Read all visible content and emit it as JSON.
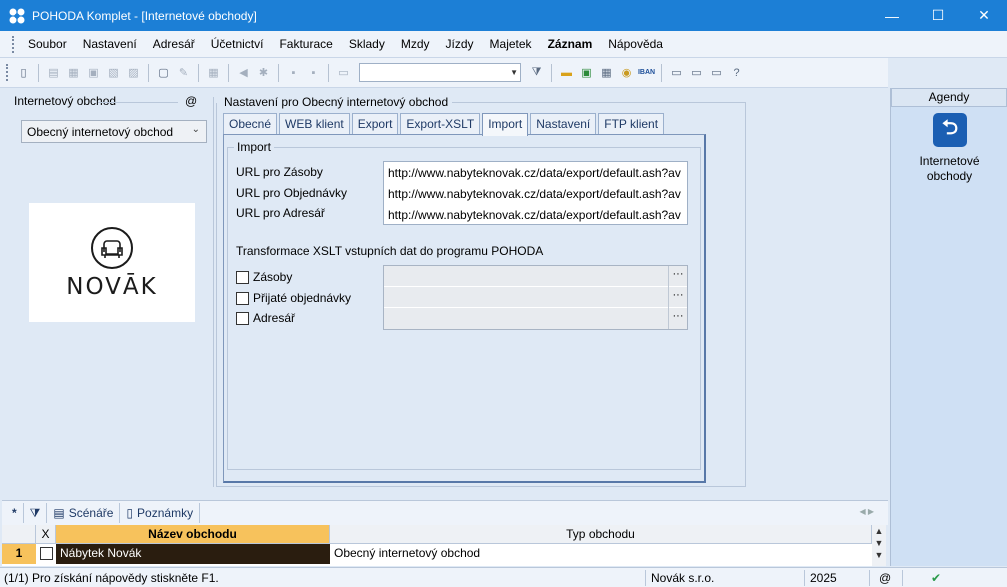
{
  "window": {
    "title": "POHODA Komplet - [Internetové obchody]",
    "minimize": "—",
    "maximize": "☐",
    "close": "✕"
  },
  "menu": [
    "Soubor",
    "Nastavení",
    "Adresář",
    "Účetnictví",
    "Fakturace",
    "Sklady",
    "Mzdy",
    "Jízdy",
    "Majetek",
    "Záznam",
    "Nápověda"
  ],
  "left": {
    "title": "Internetový obchod",
    "at": "@",
    "selected_shop": "Obecný internetový obchod",
    "logo_text": "NOVĀK"
  },
  "settings": {
    "title": "Nastavení pro Obecný internetový obchod",
    "tabs": [
      "Obecné",
      "WEB klient",
      "Export",
      "Export-XSLT",
      "Import",
      "Nastavení",
      "FTP klient"
    ],
    "active_tab": "Import",
    "import": {
      "group_title": "Import",
      "url_labels": [
        "URL pro Zásoby",
        "URL pro Objednávky",
        "URL pro Adresář"
      ],
      "urls": [
        "http://www.nabyteknovak.cz/data/export/default.ash?av",
        "http://www.nabyteknovak.cz/data/export/default.ash?av",
        "http://www.nabyteknovak.cz/data/export/default.ash?av"
      ],
      "xslt_title": "Transformace XSLT vstupních dat do programu POHODA",
      "xslt_items": [
        "Zásoby",
        "Přijaté objednávky",
        "Adresář"
      ],
      "browse": "···"
    }
  },
  "agenda": {
    "title": "Agendy",
    "item_line1": "Internetové",
    "item_line2": "obchody"
  },
  "bottom_tabs": {
    "star": "*",
    "scenare": "Scénáře",
    "poznamky": "Poznámky"
  },
  "grid": {
    "col_x": "X",
    "col_name": "Název obchodu",
    "col_type": "Typ obchodu",
    "row_num": "1",
    "row_name": "Nábytek Novák",
    "row_type": "Obecný internetový obchod"
  },
  "status": {
    "hint": "(1/1) Pro získání nápovědy stiskněte F1.",
    "company": "Novák s.r.o.",
    "year": "2025",
    "at": "@"
  }
}
